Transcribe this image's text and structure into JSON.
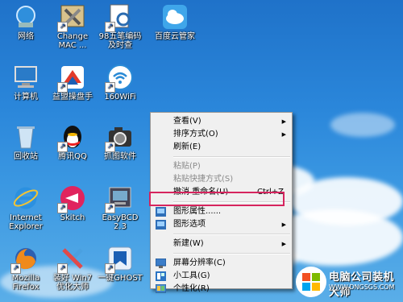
{
  "desktop": {
    "icons": [
      {
        "label": "网络"
      },
      {
        "label": "Change\nMAC ..."
      },
      {
        "label": "98五笔编码\n及时查"
      },
      {
        "label": "百度云管家"
      },
      {
        "label": "计算机"
      },
      {
        "label": "益盟操盘手"
      },
      {
        "label": "160WiFi"
      },
      {
        "label": "回收站"
      },
      {
        "label": "腾讯QQ"
      },
      {
        "label": "抓图软件"
      },
      {
        "label": "Internet\nExplorer"
      },
      {
        "label": "Skitch"
      },
      {
        "label": "EasyBCD\n2.3"
      },
      {
        "label": "Mozilla\nFirefox"
      },
      {
        "label": "装好 Win7\n优化大师"
      },
      {
        "label": "一键GHOST"
      }
    ]
  },
  "context_menu": {
    "view": "查看(V)",
    "sort": "排序方式(O)",
    "refresh": "刷新(E)",
    "paste": "粘贴(P)",
    "paste_shortcut": "粘贴快捷方式(S)",
    "undo_rename": "撤消 重命名(U)",
    "undo_shortcut": "Ctrl+Z",
    "graphics_properties": "图形属性......",
    "graphics_options": "图形选项",
    "new": "新建(W)",
    "screen_resolution": "屏幕分辨率(C)",
    "gadgets": "小工具(G)",
    "personalize": "个性化(R)"
  },
  "watermark": {
    "title": "电脑公司装机大师",
    "url": "WWW.DNGSGS.COM"
  },
  "colors": {
    "highlight_border": "#d6245e",
    "desktop_blue": "#2a86da"
  }
}
